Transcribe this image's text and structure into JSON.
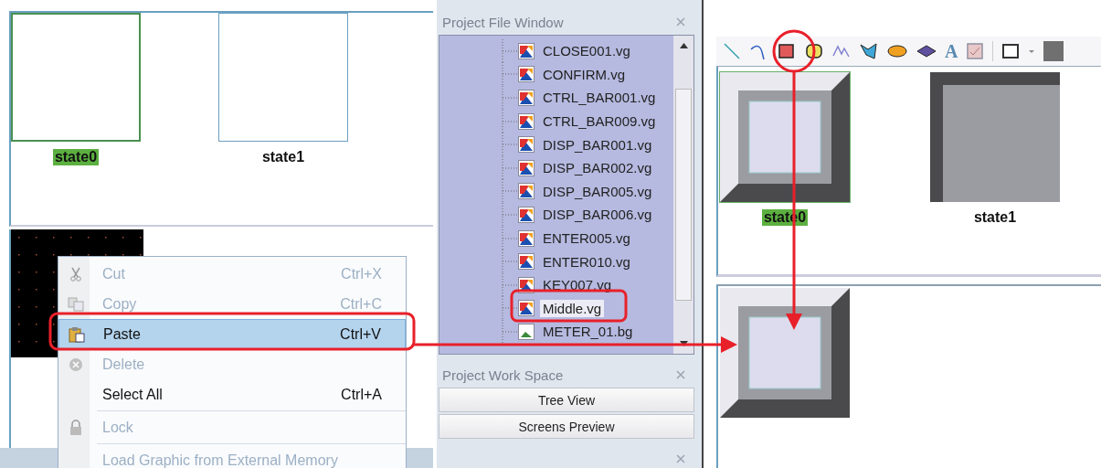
{
  "left_top_panel": {
    "states": [
      {
        "label": "state0",
        "selected": true
      },
      {
        "label": "state1",
        "selected": false
      }
    ]
  },
  "context_menu": {
    "items": [
      {
        "kind": "cut",
        "label": "Cut",
        "shortcut": "Ctrl+X",
        "disabled": true,
        "selected": false
      },
      {
        "kind": "copy",
        "label": "Copy",
        "shortcut": "Ctrl+C",
        "disabled": true,
        "selected": false
      },
      {
        "kind": "paste",
        "label": "Paste",
        "shortcut": "Ctrl+V",
        "disabled": false,
        "selected": true
      },
      {
        "kind": "delete",
        "label": "Delete",
        "disabled": true,
        "selected": false
      },
      {
        "kind": "select_all",
        "label": "Select All",
        "shortcut": "Ctrl+A",
        "disabled": false,
        "selected": false
      },
      {
        "kind": "separator"
      },
      {
        "kind": "lock",
        "label": "Lock",
        "disabled": true,
        "selected": false
      },
      {
        "kind": "separator"
      },
      {
        "kind": "load",
        "label": "Load Graphic from External Memory",
        "disabled": true,
        "selected": false
      }
    ]
  },
  "project_file_window": {
    "title": "Project File Window",
    "files": [
      {
        "name": "CLOSE001.vg",
        "kind": "vg",
        "selected": false
      },
      {
        "name": "CONFIRM.vg",
        "kind": "vg",
        "selected": false
      },
      {
        "name": "CTRL_BAR001.vg",
        "kind": "vg",
        "selected": false
      },
      {
        "name": "CTRL_BAR009.vg",
        "kind": "vg",
        "selected": false
      },
      {
        "name": "DISP_BAR001.vg",
        "kind": "vg",
        "selected": false
      },
      {
        "name": "DISP_BAR002.vg",
        "kind": "vg",
        "selected": false
      },
      {
        "name": "DISP_BAR005.vg",
        "kind": "vg",
        "selected": false
      },
      {
        "name": "DISP_BAR006.vg",
        "kind": "vg",
        "selected": false
      },
      {
        "name": "ENTER005.vg",
        "kind": "vg",
        "selected": false
      },
      {
        "name": "ENTER010.vg",
        "kind": "vg",
        "selected": false
      },
      {
        "name": "KEY007.vg",
        "kind": "vg",
        "selected": false
      },
      {
        "name": "Middle.vg",
        "kind": "vg",
        "selected": true
      },
      {
        "name": "METER_01.bg",
        "kind": "bg",
        "selected": false
      }
    ]
  },
  "project_work_space": {
    "title": "Project Work Space",
    "buttons": [
      "Tree View",
      "Screens Preview"
    ]
  },
  "toolbar": {
    "text_tool": "A"
  },
  "right_top_panel": {
    "states": [
      {
        "label": "state0",
        "selected": true
      },
      {
        "label": "state1",
        "selected": false
      }
    ]
  }
}
